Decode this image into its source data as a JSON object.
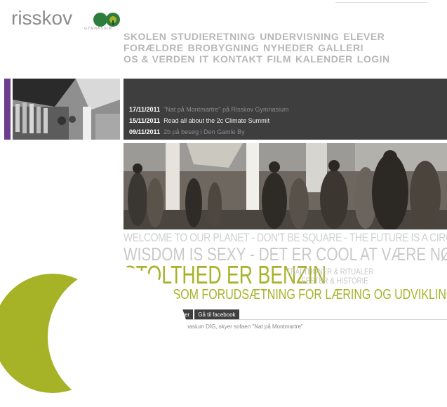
{
  "logo": {
    "text": "risskov",
    "subtext": "GYMNASIUM"
  },
  "nav": {
    "row1": [
      "SKOLEN",
      "STUDIERETNING",
      "UNDERVISNING",
      "ELEVER"
    ],
    "row2": [
      "FORÆLDRE",
      "BROBYGNING",
      "NYHEDER",
      "GALLERI"
    ],
    "row3": [
      "OS & VERDEN",
      "IT",
      "KONTAKT",
      "FILM",
      "KALENDER",
      "LOGIN"
    ]
  },
  "news": [
    {
      "date": "17/11/2011",
      "title": "\"Nat på Montmartre\" på Risskov Gymnasium"
    },
    {
      "date": "15/11/2011",
      "title": "Read all about the 2c Climate Summit"
    },
    {
      "date": "09/11/2011",
      "title": "2b på besøg i Den Gamle By"
    }
  ],
  "slogans": {
    "line1": "WELCOME TO OUR PLANET - DON'T BE SQUARE - THE FUTURE IS A CIRCLE",
    "line2": "WISDOM IS SEXY - DET ER COOL AT VÆRE NØRD",
    "line3": "STOLTHED ER BENZIN",
    "line3_side_a": "TRADITIONER & RITUALER",
    "line3_side_b": "... FESTER & HISTORIE",
    "line4": "TRIVSEL SOM FORUDSÆTNING FOR LÆRING OG UDVIKLING"
  },
  "facebook": {
    "tab1": "Facebook opdateringer",
    "tab2": "Gå til facebook",
    "post_text": "Risskov Gymnasium DIG, skyer sofaen \"Nat på Montmartre\""
  },
  "colors": {
    "accent_green": "#a6b327",
    "purple": "#6b3f8e",
    "dark_panel": "#3e3e3e"
  }
}
